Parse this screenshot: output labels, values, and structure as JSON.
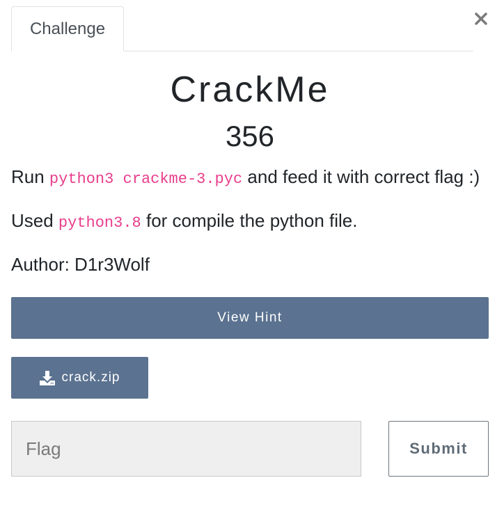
{
  "tabs": [
    {
      "label": "Challenge",
      "active": true
    }
  ],
  "close_icon": "close-icon",
  "challenge": {
    "name": "CrackMe",
    "points": "356",
    "description": {
      "line1": {
        "prefix": "Run ",
        "code": "python3 crackme-3.pyc",
        "suffix": " and feed it with correct flag :)"
      },
      "line2": {
        "prefix": "Used ",
        "code": "python3.8",
        "suffix": " for compile the python file."
      },
      "line3": "Author: D1r3Wolf"
    }
  },
  "hint_button": {
    "label": "View Hint"
  },
  "file_button": {
    "label": "crack.zip",
    "icon": "download-icon"
  },
  "flag_input": {
    "placeholder": "Flag",
    "value": ""
  },
  "submit_button": {
    "label": "Submit"
  },
  "colors": {
    "button_bg": "#5b7290",
    "code": "#e83e8c",
    "input_bg": "#efefef"
  }
}
